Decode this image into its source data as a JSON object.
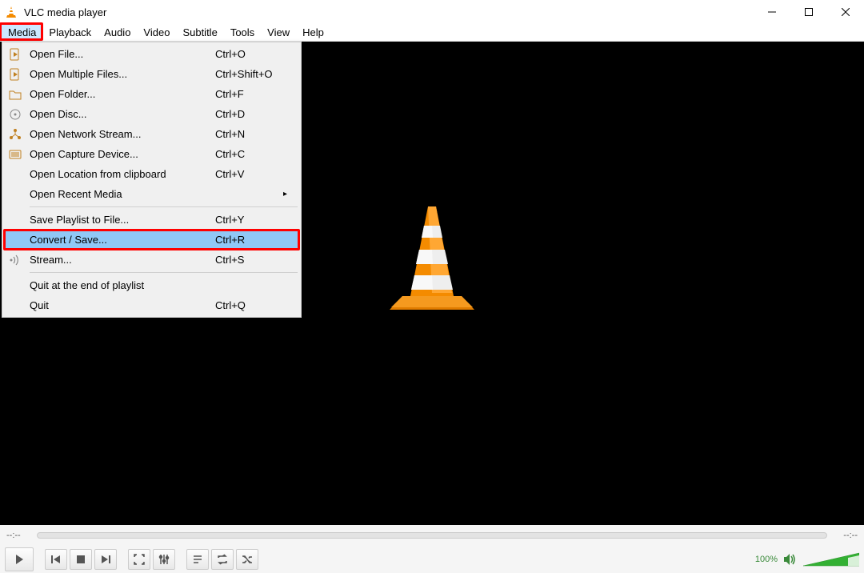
{
  "titlebar": {
    "title": "VLC media player"
  },
  "menubar": {
    "items": [
      "Media",
      "Playback",
      "Audio",
      "Video",
      "Subtitle",
      "Tools",
      "View",
      "Help"
    ],
    "active_index": 0
  },
  "dropdown": {
    "groups": [
      [
        {
          "icon": "file-play",
          "label": "Open File...",
          "shortcut": "Ctrl+O"
        },
        {
          "icon": "file-play",
          "label": "Open Multiple Files...",
          "shortcut": "Ctrl+Shift+O"
        },
        {
          "icon": "folder",
          "label": "Open Folder...",
          "shortcut": "Ctrl+F"
        },
        {
          "icon": "disc",
          "label": "Open Disc...",
          "shortcut": "Ctrl+D"
        },
        {
          "icon": "network",
          "label": "Open Network Stream...",
          "shortcut": "Ctrl+N"
        },
        {
          "icon": "capture",
          "label": "Open Capture Device...",
          "shortcut": "Ctrl+C"
        },
        {
          "icon": "",
          "label": "Open Location from clipboard",
          "shortcut": "Ctrl+V"
        },
        {
          "icon": "",
          "label": "Open Recent Media",
          "shortcut": "",
          "submenu": true
        }
      ],
      [
        {
          "icon": "",
          "label": "Save Playlist to File...",
          "shortcut": "Ctrl+Y"
        },
        {
          "icon": "",
          "label": "Convert / Save...",
          "shortcut": "Ctrl+R",
          "selected": true,
          "highlight": true
        },
        {
          "icon": "stream",
          "label": "Stream...",
          "shortcut": "Ctrl+S"
        }
      ],
      [
        {
          "icon": "",
          "label": "Quit at the end of playlist",
          "shortcut": ""
        },
        {
          "icon": "",
          "label": "Quit",
          "shortcut": "Ctrl+Q"
        }
      ]
    ]
  },
  "seekbar": {
    "time_left": "--:--",
    "time_right": "--:--"
  },
  "volume": {
    "percent": "100%"
  }
}
